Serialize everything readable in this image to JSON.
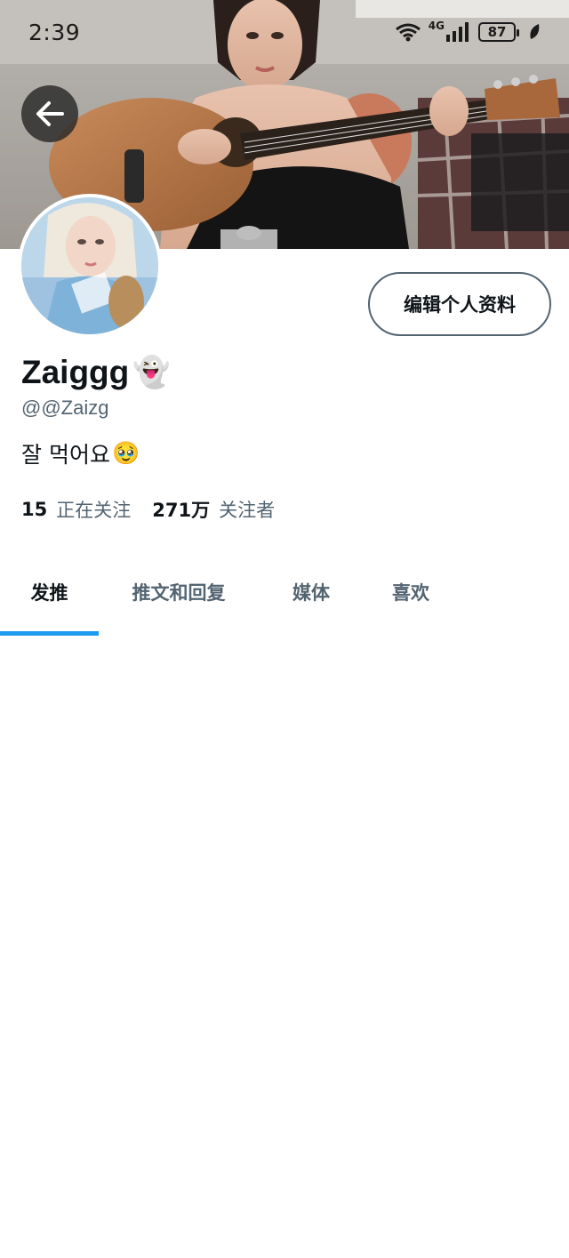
{
  "status_bar": {
    "time": "2:39",
    "network": "4G",
    "battery": "87"
  },
  "header": {
    "back_icon": "arrow-left-icon"
  },
  "profile": {
    "edit_button_label": "编辑个人资料",
    "display_name": "Zaiggg",
    "display_name_emoji": "👻",
    "handle": "@@Zaizg",
    "bio_text": "잘 먹어요",
    "bio_emoji": "🥹",
    "following_count": "15",
    "following_label": "正在关注",
    "followers_count": "271万",
    "followers_label": "关注者"
  },
  "tabs": [
    {
      "label": "发推",
      "active": true
    },
    {
      "label": "推文和回复",
      "active": false
    },
    {
      "label": "媒体",
      "active": false
    },
    {
      "label": "喜欢",
      "active": false
    }
  ],
  "colors": {
    "accent": "#1d9bf0",
    "secondary_text": "#536471",
    "primary_text": "#0f1419"
  }
}
